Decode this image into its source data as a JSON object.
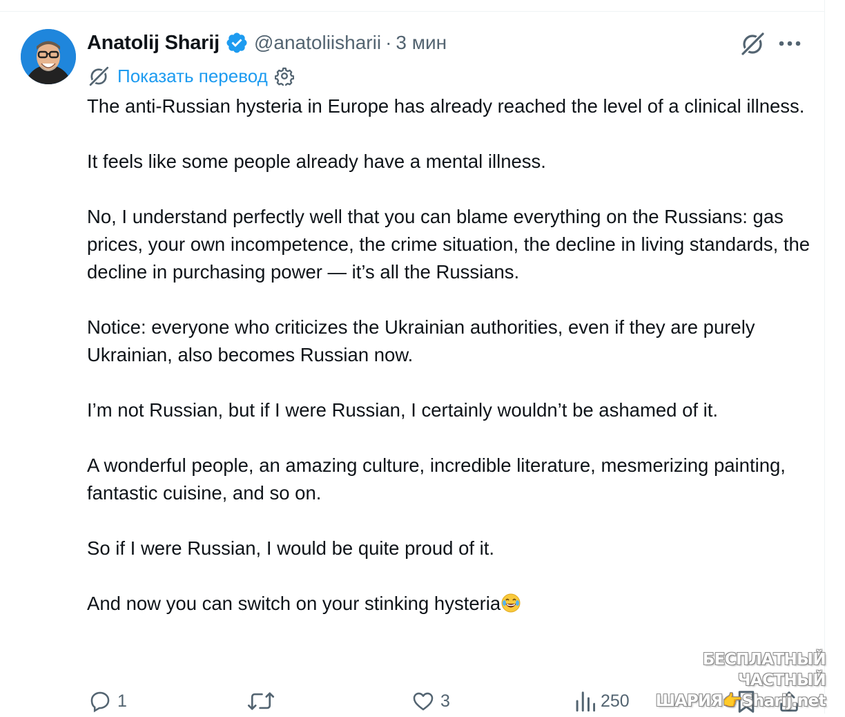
{
  "author": {
    "name": "Anatolij Sharij",
    "handle": "@anatoliisharii",
    "time": "3 мин",
    "separator": "·"
  },
  "translate": {
    "label": "Показать перевод"
  },
  "tweet": {
    "text": "The anti-Russian hysteria in Europe has already reached the level of a clinical illness.\n\nIt feels like some people already have a mental illness.\n\nNo, I understand perfectly well that you can blame everything on the Russians: gas prices, your own incompetence, the crime situation, the decline in living standards, the decline in purchasing power — it’s all the Russians.\n\nNotice: everyone who criticizes the Ukrainian authorities, even if they are purely Ukrainian, also becomes Russian now.\n\nI’m not Russian, but if I were Russian, I certainly wouldn’t be ashamed of it.\n\nA wonderful people, an amazing culture, incredible literature, mesmerizing painting, fantastic cuisine, and so on.\n\nSo if I were Russian, I would be quite proud of it.\n\nAnd now you can switch on your stinking hysteria",
    "emoji": "😂"
  },
  "actions": {
    "replies": "1",
    "reposts": "",
    "likes": "3",
    "views": "250"
  },
  "watermark": {
    "line1": "БЕСПЛАТНЫЙ ЧАСТНЫЙ",
    "line2": "ШАРИЯ👉Sharij.net"
  },
  "colors": {
    "text": "#0f1419",
    "secondary": "#536471",
    "link": "#1d9bf0",
    "verified": "#1d9bf0"
  }
}
